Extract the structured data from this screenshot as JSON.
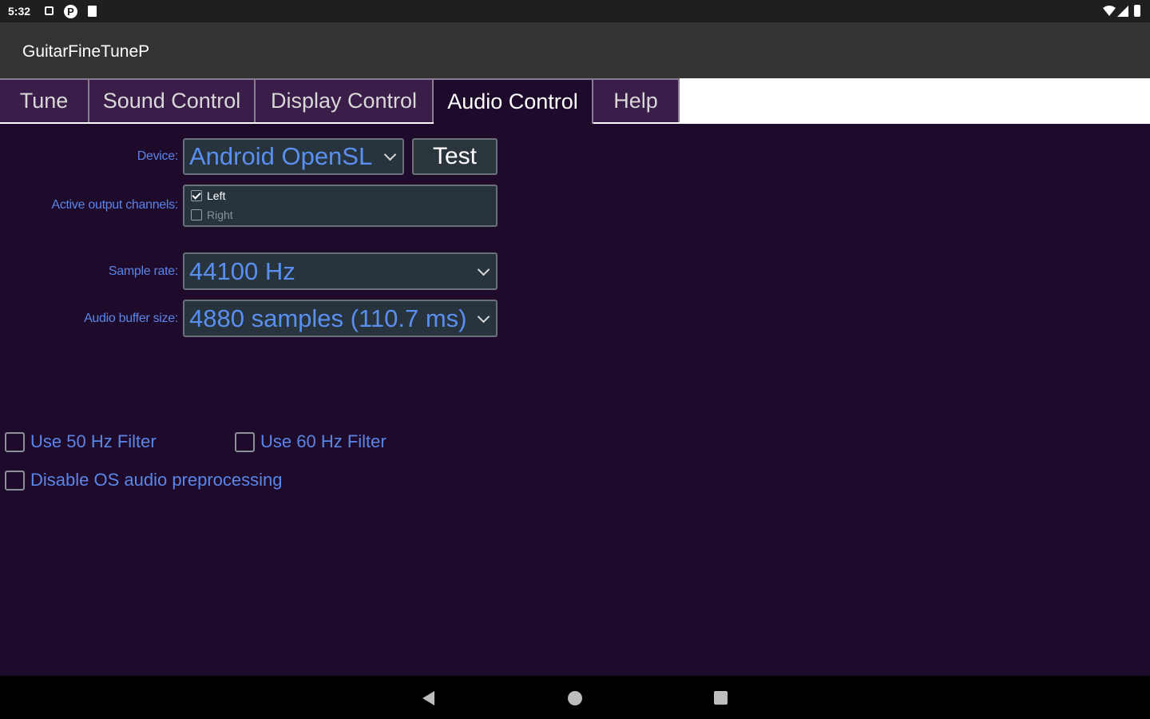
{
  "status_bar": {
    "time": "5:32",
    "p_icon_glyph": "P"
  },
  "app": {
    "title": "GuitarFineTuneP"
  },
  "tabs": [
    {
      "label": "Tune",
      "active": false
    },
    {
      "label": "Sound Control",
      "active": false
    },
    {
      "label": "Display Control",
      "active": false
    },
    {
      "label": "Audio Control",
      "active": true
    },
    {
      "label": "Help",
      "active": false
    }
  ],
  "device": {
    "label": "Device:",
    "value": "Android OpenSL",
    "test_label": "Test"
  },
  "channels": {
    "label": "Active output channels:",
    "items": [
      {
        "label": "Left",
        "checked": true
      },
      {
        "label": "Right",
        "checked": false
      }
    ]
  },
  "sample_rate": {
    "label": "Sample rate:",
    "value": "44100 Hz"
  },
  "buffer_size": {
    "label": "Audio buffer size:",
    "value": "4880 samples (110.7 ms)"
  },
  "options": {
    "filter_50": {
      "label": "Use 50 Hz Filter",
      "checked": false
    },
    "filter_60": {
      "label": "Use 60 Hz Filter",
      "checked": false
    },
    "disable_preprocessing": {
      "label": "Disable OS audio preprocessing",
      "checked": false
    }
  },
  "colors": {
    "background": "#1e0a2a",
    "accent_text": "#5a86e8",
    "tab_bg": "#3a1d48",
    "control_bg": "#28343d"
  },
  "icons": [
    "notification-square-icon",
    "p-badge-icon",
    "sd-card-icon",
    "wifi-icon",
    "cell-signal-icon",
    "battery-icon",
    "nav-back-icon",
    "nav-home-icon",
    "nav-recents-icon",
    "chevron-down-icon",
    "checkbox-icon"
  ]
}
